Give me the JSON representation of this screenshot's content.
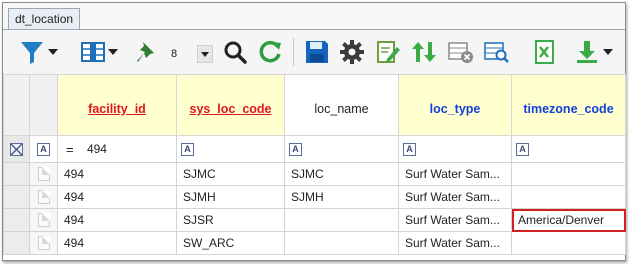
{
  "tab": {
    "label": "dt_location"
  },
  "toolbar": {
    "rows_value": "8",
    "buttons": [
      "filter-icon",
      "columns-icon",
      "pin-icon",
      "search-icon",
      "refresh-icon",
      "save-icon",
      "settings-icon",
      "edit-icon",
      "sort-icon",
      "delete-row-icon",
      "find-records-icon",
      "excel-icon",
      "download-icon"
    ],
    "colors": {
      "filter": "#1f7ec4",
      "pin": "#2e7d32",
      "refresh": "#2e9e3e",
      "save": "#1565c0",
      "settings": "#3a3a3a",
      "green": "#3cab47"
    }
  },
  "grid": {
    "columns": [
      {
        "label": "facility_id",
        "style": "required"
      },
      {
        "label": "sys_loc_code",
        "style": "required"
      },
      {
        "label": "loc_name",
        "style": "optional"
      },
      {
        "label": "loc_type",
        "style": "key"
      },
      {
        "label": "timezone_code",
        "style": "key"
      }
    ],
    "filter": {
      "operator": "=",
      "value": "494",
      "box_label": "A"
    },
    "rows": [
      {
        "facility_id": "494",
        "sys_loc_code": "SJMC",
        "loc_name": "SJMC",
        "loc_type": "Surf Water Sam...",
        "timezone_code": ""
      },
      {
        "facility_id": "494",
        "sys_loc_code": "SJMH",
        "loc_name": "SJMH",
        "loc_type": "Surf Water Sam...",
        "timezone_code": ""
      },
      {
        "facility_id": "494",
        "sys_loc_code": "SJSR",
        "loc_name": "",
        "loc_type": "Surf Water Sam...",
        "timezone_code": "America/Denver"
      },
      {
        "facility_id": "494",
        "sys_loc_code": "SW_ARC",
        "loc_name": "",
        "loc_type": "Surf Water Sam...",
        "timezone_code": ""
      }
    ],
    "selected_cell": {
      "row": 3,
      "column": "timezone_code"
    },
    "colors": {
      "required": "#e0161c",
      "key": "#1340d8",
      "header_fill": "#ffffcf",
      "selection": "#d21f1f"
    }
  }
}
